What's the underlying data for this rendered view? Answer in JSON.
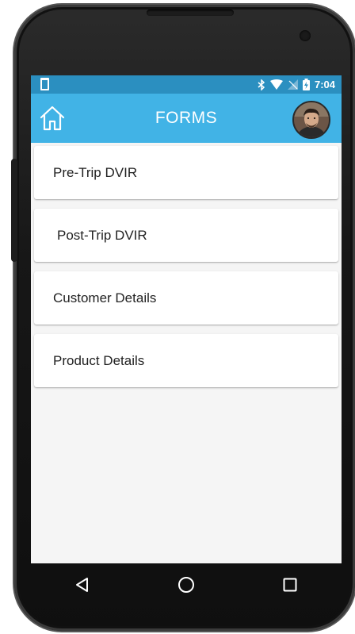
{
  "status_bar": {
    "time": "7:04",
    "icons": [
      "phone-icon",
      "bluetooth-icon",
      "wifi-icon",
      "no-signal-icon",
      "battery-charging-icon"
    ]
  },
  "app_bar": {
    "title": "FORMS",
    "home_icon": "home-icon",
    "avatar": "user-avatar"
  },
  "forms": {
    "items": [
      {
        "label": "Pre-Trip DVIR"
      },
      {
        "label": "Post-Trip DVIR"
      },
      {
        "label": "Customer Details"
      },
      {
        "label": "Product Details"
      }
    ]
  },
  "nav_bar": {
    "buttons": [
      "back-icon",
      "home-circle-icon",
      "recents-icon"
    ]
  },
  "colors": {
    "status_bar": "#2b8fc0",
    "app_bar": "#41b3e6",
    "background": "#f5f5f5",
    "card": "#ffffff",
    "nav_bar": "#101010"
  }
}
